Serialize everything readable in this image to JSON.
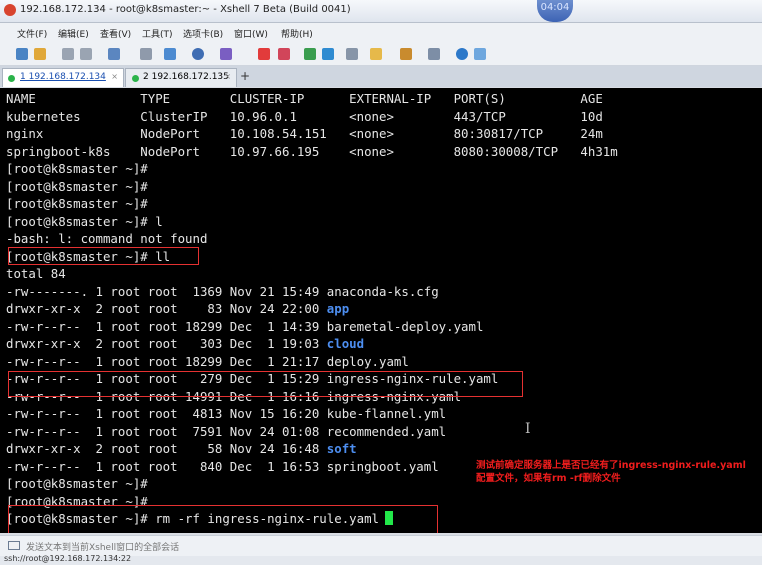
{
  "window": {
    "title": "192.168.172.134 - root@k8smaster:~ - Xshell 7 Beta (Build 0041)",
    "clock": "04:04"
  },
  "menu": [
    {
      "label": "文件(F)"
    },
    {
      "label": "编辑(E)"
    },
    {
      "label": "查看(V)"
    },
    {
      "label": "工具(T)"
    },
    {
      "label": "选项卡(B)"
    },
    {
      "label": "窗口(W)"
    },
    {
      "label": "帮助(H)"
    }
  ],
  "tabs": [
    {
      "label": "1 192.168.172.134",
      "status_color": "#2bb34a"
    },
    {
      "label": "2 192.168.172.135",
      "status_color": "#2bb34a"
    }
  ],
  "tab_close": "×",
  "tab_add": "+",
  "terminal": {
    "lines": [
      {
        "text": "NAME              TYPE        CLUSTER-IP      EXTERNAL-IP   PORT(S)          AGE"
      },
      {
        "text": "kubernetes        ClusterIP   10.96.0.1       <none>        443/TCP          10d"
      },
      {
        "text": "nginx             NodePort    10.108.54.151   <none>        80:30817/TCP     24m"
      },
      {
        "text": "springboot-k8s    NodePort    10.97.66.195    <none>        8080:30008/TCP   4h31m"
      },
      {
        "text": "[root@k8smaster ~]#"
      },
      {
        "text": "[root@k8smaster ~]#"
      },
      {
        "text": "[root@k8smaster ~]#"
      },
      {
        "text": "[root@k8smaster ~]# l"
      },
      {
        "text": "-bash: l: command not found"
      },
      {
        "text": "[root@k8smaster ~]# ll"
      },
      {
        "text": "total 84"
      },
      {
        "text": "-rw-------. 1 root root  1369 Nov 21 15:49 anaconda-ks.cfg"
      },
      {
        "text": "drwxr-xr-x  2 root root    83 Nov 24 22:00 ",
        "dir": "app"
      },
      {
        "text": "-rw-r--r--  1 root root 18299 Dec  1 14:39 baremetal-deploy.yaml"
      },
      {
        "text": "drwxr-xr-x  2 root root   303 Dec  1 19:03 ",
        "dir": "cloud"
      },
      {
        "text": "-rw-r--r--  1 root root 18299 Dec  1 21:17 deploy.yaml"
      },
      {
        "text": "-rw-r--r--  1 root root   279 Dec  1 15:29 ingress-nginx-rule.yaml"
      },
      {
        "text": "-rw-r--r--  1 root root 14991 Dec  1 16:16 ingress-nginx.yaml"
      },
      {
        "text": "-rw-r--r--  1 root root  4813 Nov 15 16:20 kube-flannel.yml"
      },
      {
        "text": "-rw-r--r--  1 root root  7591 Nov 24 01:08 recommended.yaml"
      },
      {
        "text": "drwxr-xr-x  2 root root    58 Nov 24 16:48 ",
        "dir": "soft"
      },
      {
        "text": "-rw-r--r--  1 root root   840 Dec  1 16:53 springboot.yaml"
      },
      {
        "text": "[root@k8smaster ~]#"
      },
      {
        "text": "[root@k8smaster ~]#"
      },
      {
        "text": "[root@k8smaster ~]# rm -rf ingress-nginx-rule.yaml"
      }
    ],
    "note_line1": "测试前确定服务器上是否已经有了ingress-nginx-rule.yaml",
    "note_line2": "配置文件，如果有rm -rf删除文件",
    "ibeam": "I"
  },
  "composer": {
    "placeholder": "发送文本到当前Xshell窗口的全部会话"
  },
  "statusbar": {
    "text": "ssh://root@192.168.172.134:22"
  }
}
